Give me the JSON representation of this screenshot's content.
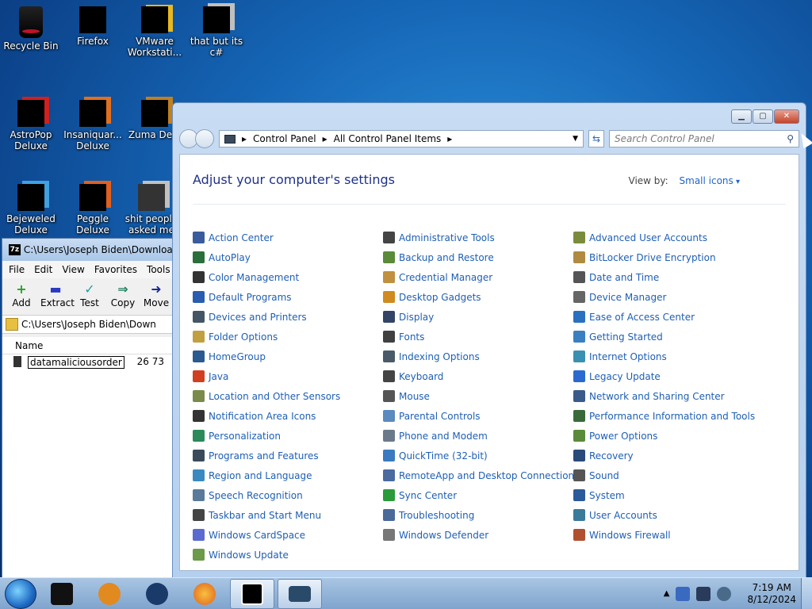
{
  "desktop": {
    "icons": [
      {
        "label": "Recycle Bin"
      },
      {
        "label": "Firefox"
      },
      {
        "label": "VMware Workstati..."
      },
      {
        "label": "that but its c#"
      },
      {
        "label": "AstroPop Deluxe"
      },
      {
        "label": "Insaniquar... Deluxe"
      },
      {
        "label": "Zuma Delu"
      },
      {
        "label": "Bejeweled Deluxe"
      },
      {
        "label": "Peggle Deluxe"
      },
      {
        "label": "shit people asked me"
      }
    ]
  },
  "zip": {
    "title": "C:\\Users\\Joseph Biden\\Downloads\\",
    "logo": "7z",
    "menu": [
      "File",
      "Edit",
      "View",
      "Favorites",
      "Tools"
    ],
    "tools": [
      {
        "label": "Add",
        "icon": "+"
      },
      {
        "label": "Extract",
        "icon": "▬"
      },
      {
        "label": "Test",
        "icon": "✓"
      },
      {
        "label": "Copy",
        "icon": "⇒"
      },
      {
        "label": "Move",
        "icon": "➜"
      }
    ],
    "path": "C:\\Users\\Joseph Biden\\Down",
    "column_name": "Name",
    "file": {
      "name": "datamaliciousorder",
      "size": "26 73"
    }
  },
  "cp": {
    "breadcrumb": [
      "Control Panel",
      "All Control Panel Items"
    ],
    "search_placeholder": "Search Control Panel",
    "heading": "Adjust your computer's settings",
    "viewby_label": "View by:",
    "viewby_value": "Small icons",
    "items": [
      {
        "label": "Action Center",
        "color": "#3a5c9c"
      },
      {
        "label": "Administrative Tools",
        "color": "#444444"
      },
      {
        "label": "Advanced User Accounts",
        "color": "#7a8c3c"
      },
      {
        "label": "AutoPlay",
        "color": "#2a6e3c"
      },
      {
        "label": "Backup and Restore",
        "color": "#5a8a3a"
      },
      {
        "label": "BitLocker Drive Encryption",
        "color": "#b08a40"
      },
      {
        "label": "Color Management",
        "color": "#333333"
      },
      {
        "label": "Credential Manager",
        "color": "#c09040"
      },
      {
        "label": "Date and Time",
        "color": "#555555"
      },
      {
        "label": "Default Programs",
        "color": "#2a5cb0"
      },
      {
        "label": "Desktop Gadgets",
        "color": "#d08a20"
      },
      {
        "label": "Device Manager",
        "color": "#666666"
      },
      {
        "label": "Devices and Printers",
        "color": "#445566"
      },
      {
        "label": "Display",
        "color": "#334466"
      },
      {
        "label": "Ease of Access Center",
        "color": "#2a70c0"
      },
      {
        "label": "Folder Options",
        "color": "#c0a040"
      },
      {
        "label": "Fonts",
        "color": "#404040"
      },
      {
        "label": "Getting Started",
        "color": "#3a80c0"
      },
      {
        "label": "HomeGroup",
        "color": "#2a5a90"
      },
      {
        "label": "Indexing Options",
        "color": "#4a5a6a"
      },
      {
        "label": "Internet Options",
        "color": "#3a90b0"
      },
      {
        "label": "Java",
        "color": "#d04020"
      },
      {
        "label": "Keyboard",
        "color": "#444444"
      },
      {
        "label": "Legacy Update",
        "color": "#2a6ad0"
      },
      {
        "label": "Location and Other Sensors",
        "color": "#7a8a4a"
      },
      {
        "label": "Mouse",
        "color": "#555555"
      },
      {
        "label": "Network and Sharing Center",
        "color": "#3a5a8a"
      },
      {
        "label": "Notification Area Icons",
        "color": "#333333"
      },
      {
        "label": "Parental Controls",
        "color": "#5a8ac0"
      },
      {
        "label": "Performance Information and Tools",
        "color": "#3a6a3a"
      },
      {
        "label": "Personalization",
        "color": "#2a8a5a"
      },
      {
        "label": "Phone and Modem",
        "color": "#6a7a8a"
      },
      {
        "label": "Power Options",
        "color": "#5a8a3a"
      },
      {
        "label": "Programs and Features",
        "color": "#3a4a5a"
      },
      {
        "label": "QuickTime (32-bit)",
        "color": "#3a7ac0"
      },
      {
        "label": "Recovery",
        "color": "#2a4a7a"
      },
      {
        "label": "Region and Language",
        "color": "#3a8ac0"
      },
      {
        "label": "RemoteApp and Desktop Connections",
        "color": "#4a6aa0"
      },
      {
        "label": "Sound",
        "color": "#555555"
      },
      {
        "label": "Speech Recognition",
        "color": "#5a7a9a"
      },
      {
        "label": "Sync Center",
        "color": "#2a9a3a"
      },
      {
        "label": "System",
        "color": "#2a5a9a"
      },
      {
        "label": "Taskbar and Start Menu",
        "color": "#444444"
      },
      {
        "label": "Troubleshooting",
        "color": "#4a6a9a"
      },
      {
        "label": "User Accounts",
        "color": "#3a7a9a"
      },
      {
        "label": "Windows CardSpace",
        "color": "#5a6ad0"
      },
      {
        "label": "Windows Defender",
        "color": "#777777"
      },
      {
        "label": "Windows Firewall",
        "color": "#b05030"
      },
      {
        "label": "Windows Update",
        "color": "#6a9a4a"
      }
    ]
  },
  "taskbar": {
    "buttons": [
      {
        "name": "taskbar-app1",
        "color": "#111111"
      },
      {
        "name": "taskbar-media-player",
        "color": "#e08a20"
      },
      {
        "name": "taskbar-browser-globe",
        "color": "#1a3a6a"
      },
      {
        "name": "taskbar-firefox",
        "color": "#e0601a"
      },
      {
        "name": "taskbar-7zip",
        "color": "#000000"
      },
      {
        "name": "taskbar-control-panel",
        "color": "#2a4a6a"
      }
    ],
    "time": "7:19 AM",
    "date": "8/12/2024"
  }
}
